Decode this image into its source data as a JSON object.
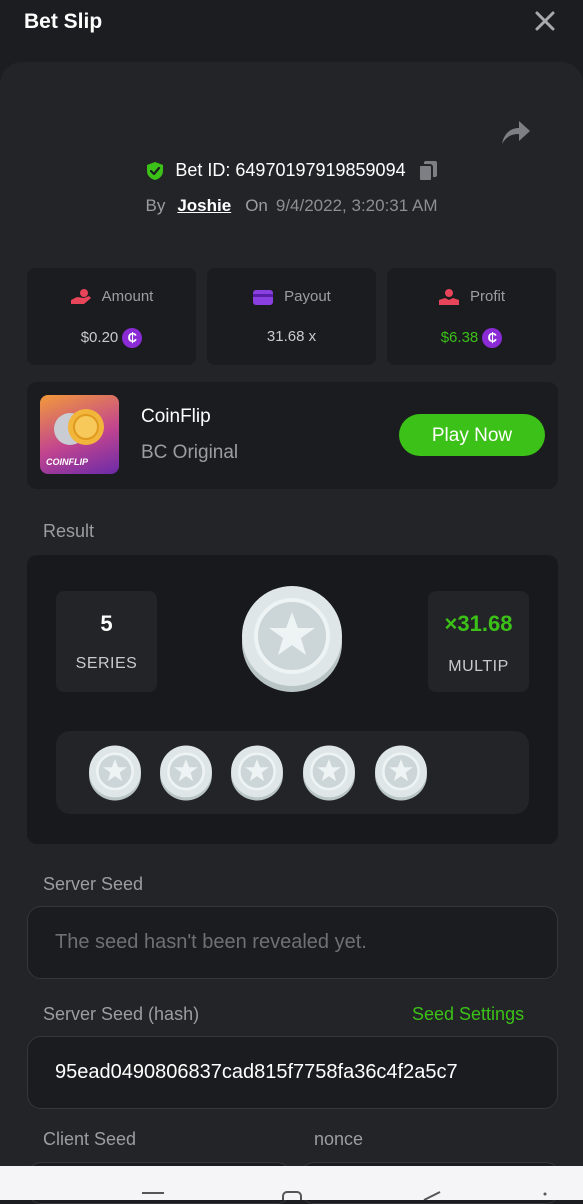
{
  "header": {
    "title": "Bet Slip"
  },
  "bet": {
    "id_text": "Bet ID: 64970197919859094",
    "by_label": "By",
    "user": "Joshie",
    "on_label": "On",
    "date": "9/4/2022, 3:20:31 AM"
  },
  "stats": [
    {
      "label": "Amount",
      "value": "$0.20",
      "value_color": "#c8cace",
      "icon": "money-hand-icon",
      "icon_color": "#e8455a",
      "coin": true
    },
    {
      "label": "Payout",
      "value": "31.68 x",
      "value_color": "#c8cace",
      "icon": "wallet-card-icon",
      "icon_color": "#8a40e0",
      "coin": false
    },
    {
      "label": "Profit",
      "value": "$6.38",
      "value_color": "#3bc117",
      "icon": "profit-hand-icon",
      "icon_color": "#e8455a",
      "coin": true
    }
  ],
  "coin_symbol": "₵",
  "game": {
    "name": "CoinFlip",
    "subtitle": "BC Original",
    "thumb_label": "COINFLIP",
    "play_label": "Play Now"
  },
  "result": {
    "label": "Result",
    "series_value": "5",
    "series_label": "SERIES",
    "multiplier_value": "×31.68",
    "multiplier_label": "MULTIP",
    "coins": [
      "silver",
      "silver",
      "silver",
      "silver",
      "silver"
    ]
  },
  "server_seed": {
    "label": "Server Seed",
    "value": "The seed hasn't been revealed yet."
  },
  "server_seed_hash": {
    "label": "Server Seed (hash)",
    "settings_label": "Seed Settings",
    "value": "95ead0490806837cad815f7758fa36c4f2a5c7"
  },
  "client_seed": {
    "label": "Client Seed"
  },
  "nonce": {
    "label": "nonce"
  },
  "colors": {
    "accent_green": "#3bc117",
    "panel": "#232427",
    "card": "#1b1c1f"
  }
}
